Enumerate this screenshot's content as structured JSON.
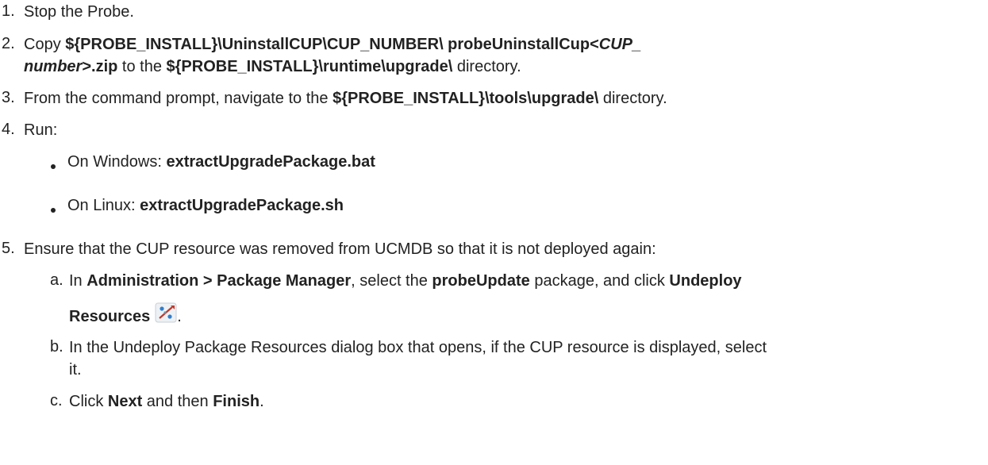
{
  "steps": [
    {
      "num": "1.",
      "text": "Stop the Probe."
    },
    {
      "num": "2.",
      "copy": "Copy",
      "path_bold": "${PROBE_INSTALL}\\UninstallCUP\\CUP_NUMBER\\ probeUninstallCup<",
      "path_italic": "CUP_",
      "path_italic2": "number",
      "path_end": ">.zip",
      "to_the": " to the ",
      "dest": "${PROBE_INSTALL}\\runtime\\upgrade\\",
      "tail": " directory."
    },
    {
      "num": "3.",
      "pre": "From the command prompt, navigate to the ",
      "dir": "${PROBE_INSTALL}\\tools\\upgrade\\",
      "tail": " directory."
    },
    {
      "num": "4.",
      "text": "Run:"
    },
    {
      "num": "5.",
      "text": "Ensure that the CUP resource was removed from UCMDB so that it is not deployed again:"
    }
  ],
  "run_items": [
    {
      "pre": "On Windows: ",
      "cmd": "extractUpgradePackage.bat"
    },
    {
      "pre": "On Linux: ",
      "cmd": "extractUpgradePackage.sh"
    }
  ],
  "substeps": [
    {
      "letter": "a.",
      "in": "In ",
      "menu": "Administration > Package Manager",
      "mid": ", select the ",
      "pkg": "probeUpdate",
      "mid2": " package, and click ",
      "btn1": "Undeploy",
      "btn2": "Resources",
      "end": "."
    },
    {
      "letter": "b.",
      "line1": "In the Undeploy Package Resources dialog box that opens, if the CUP resource is displayed, select",
      "line2": "it."
    },
    {
      "letter": "c.",
      "pre": "Click ",
      "next": "Next",
      "mid": " and then ",
      "finish": "Finish",
      "end": "."
    }
  ],
  "icons": {
    "undeploy": "undeploy-resources-icon"
  }
}
